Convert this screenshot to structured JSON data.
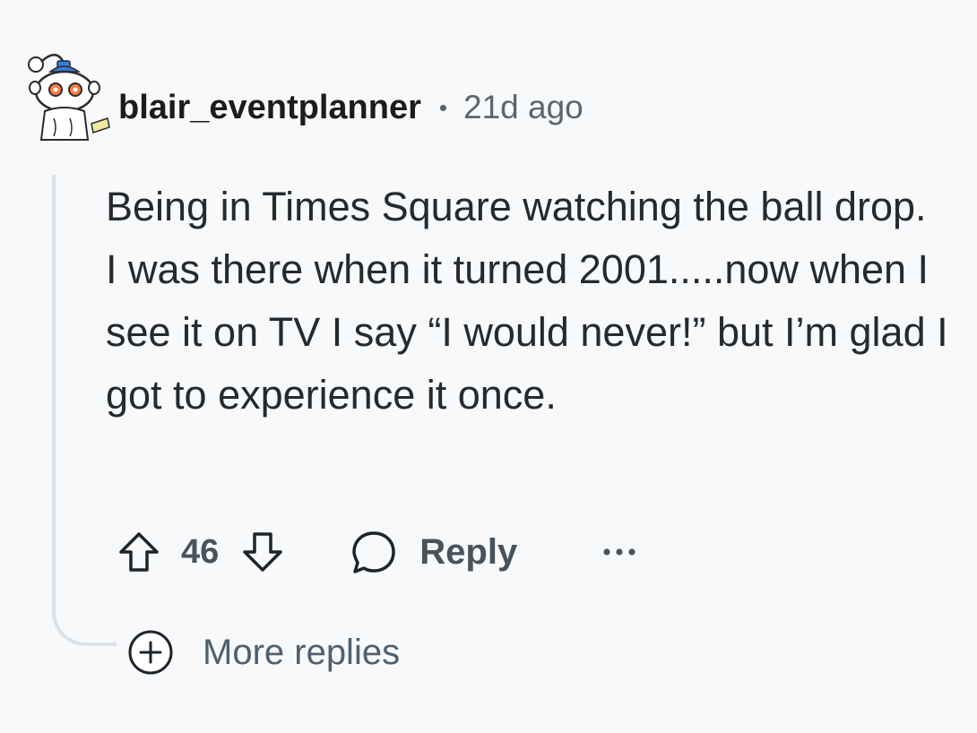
{
  "comment": {
    "username": "blair_eventplanner",
    "separator": "•",
    "time": "21d ago",
    "body": "Being in Times Square watching the ball drop. I was there when it turned 2001.....now when I see it on TV I say “I would never!” but I’m glad I got to experience it once.",
    "score": "46"
  },
  "actions": {
    "upvote_icon": "arrow-up-icon",
    "downvote_icon": "arrow-down-icon",
    "reply_icon": "speech-bubble-icon",
    "reply_label": "Reply",
    "more_icon": "ellipsis-icon"
  },
  "thread": {
    "more_replies_icon": "plus-circle-icon",
    "more_replies_label": "More replies"
  },
  "colors": {
    "background": "#f7f9fb",
    "thread_line": "#dde2e7",
    "muted_text": "#48535c",
    "link_text": "#51606e"
  }
}
